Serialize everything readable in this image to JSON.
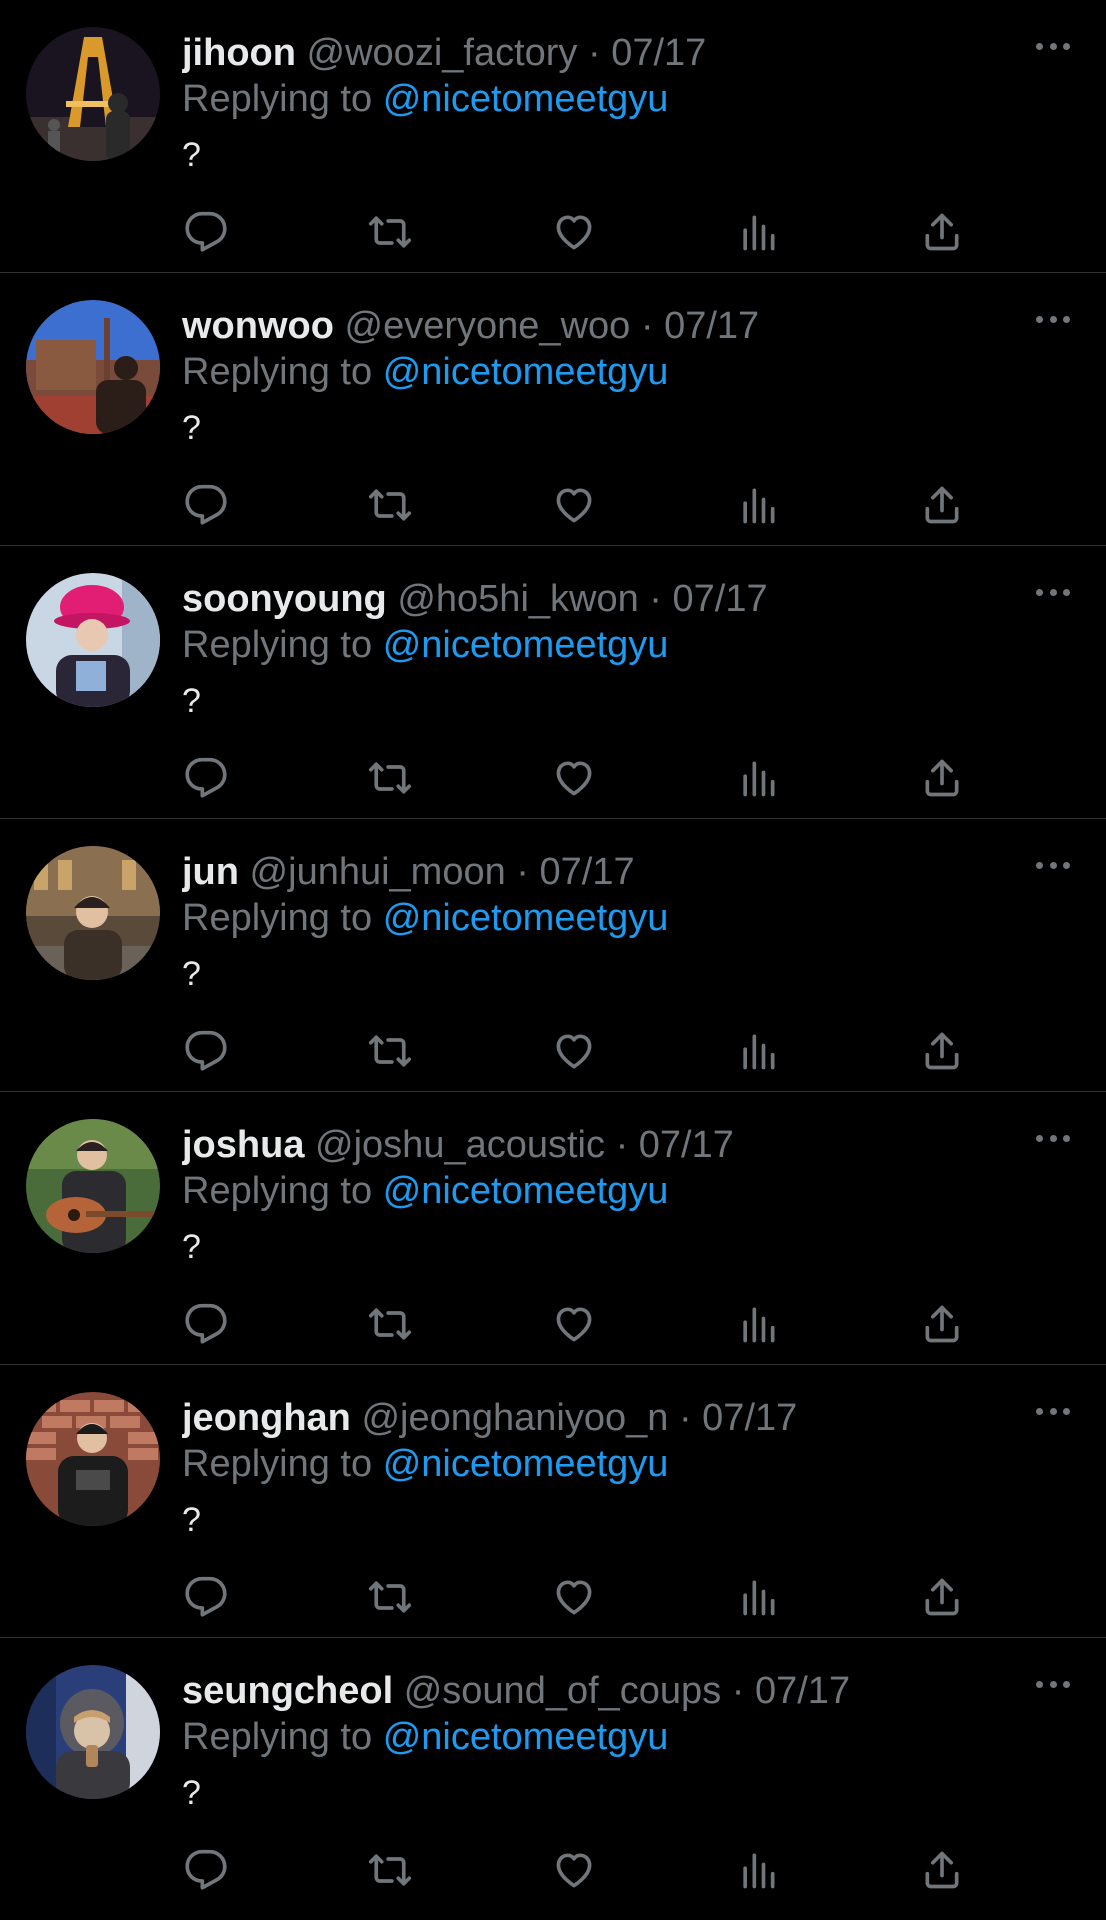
{
  "tweets": [
    {
      "name": "jihoon",
      "handle": "@woozi_factory",
      "separator": "·",
      "date": "07/17",
      "replying_label": "Replying to",
      "replying_to": "@nicetomeetgyu",
      "text": "?",
      "avatar_colors": {
        "bg": "#1a1420",
        "accent": "#d99a2b",
        "figure": "#2a2a2a"
      }
    },
    {
      "name": "wonwoo",
      "handle": "@everyone_woo",
      "separator": "·",
      "date": "07/17",
      "replying_label": "Replying to",
      "replying_to": "@nicetomeetgyu",
      "text": "?",
      "avatar_colors": {
        "bg": "#3d6fd1",
        "accent": "#c0392b",
        "figure": "#2b1d18"
      }
    },
    {
      "name": "soonyoung",
      "handle": "@ho5hi_kwon",
      "separator": "·",
      "date": "07/17",
      "replying_label": "Replying to",
      "replying_to": "@nicetomeetgyu",
      "text": "?",
      "avatar_colors": {
        "bg": "#c9d6e3",
        "accent": "#e11d74",
        "figure": "#2b2538"
      }
    },
    {
      "name": "jun",
      "handle": "@junhui_moon",
      "separator": "·",
      "date": "07/17",
      "replying_label": "Replying to",
      "replying_to": "@nicetomeetgyu",
      "text": "?",
      "avatar_colors": {
        "bg": "#5a4a3a",
        "accent": "#c8a46a",
        "figure": "#3a3028"
      }
    },
    {
      "name": "joshua",
      "handle": "@joshu_acoustic",
      "separator": "·",
      "date": "07/17",
      "replying_label": "Replying to",
      "replying_to": "@nicetomeetgyu",
      "text": "?",
      "avatar_colors": {
        "bg": "#4a6b3a",
        "accent": "#b5643a",
        "figure": "#2c2c30"
      }
    },
    {
      "name": "jeonghan",
      "handle": "@jeonghaniyoo_n",
      "separator": "·",
      "date": "07/17",
      "replying_label": "Replying to",
      "replying_to": "@nicetomeetgyu",
      "text": "?",
      "avatar_colors": {
        "bg": "#8a4a3a",
        "accent": "#c07a62",
        "figure": "#1c1c1c"
      }
    },
    {
      "name": "seungcheol",
      "handle": "@sound_of_coups",
      "separator": "·",
      "date": "07/17",
      "replying_label": "Replying to",
      "replying_to": "@nicetomeetgyu",
      "text": "?",
      "avatar_colors": {
        "bg": "#2a3f7a",
        "accent": "#d8c2a8",
        "figure": "#3a3a3e"
      }
    }
  ],
  "icons": {
    "more": "more-dots-icon",
    "reply": "reply-icon",
    "retweet": "retweet-icon",
    "like": "heart-icon",
    "views": "views-icon",
    "share": "share-icon"
  },
  "colors": {
    "background": "#000000",
    "text": "#e7e9ea",
    "muted": "#71767b",
    "link": "#1d9bf0",
    "divider": "#2f3336"
  }
}
